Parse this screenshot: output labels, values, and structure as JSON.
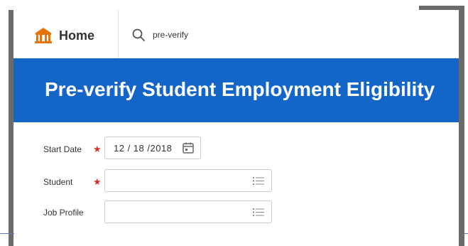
{
  "header": {
    "home_label": "Home",
    "search_value": "pre-verify",
    "icons": {
      "home": "university-building-icon",
      "search": "magnifier-icon"
    }
  },
  "banner": {
    "title": "Pre-verify Student Employment Eligibility"
  },
  "form": {
    "fields": [
      {
        "label": "Start Date",
        "required": true,
        "required_mark": "★",
        "value": "12 / 18 /2018",
        "icon": "calendar-icon"
      },
      {
        "label": "Student",
        "required": true,
        "required_mark": "★",
        "value": "",
        "icon": "prompt-list-icon"
      },
      {
        "label": "Job Profile",
        "required": false,
        "value": "",
        "icon": "prompt-list-icon"
      }
    ]
  },
  "colors": {
    "banner": "#1366c8",
    "required": "#d0342c",
    "logo": "#e8730c",
    "frame": "#6b6b6b"
  }
}
